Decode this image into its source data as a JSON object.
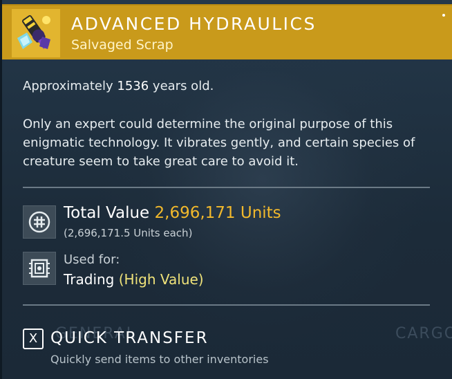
{
  "item": {
    "name": "ADVANCED HYDRAULICS",
    "category": "Salvaged Scrap",
    "icon": "hydraulic-artifact-icon"
  },
  "age": {
    "prefix": "Approximately",
    "years": "1536",
    "suffix": "years old."
  },
  "description": "Only an expert could determine the original purpose of this enigmatic technology. It vibrates gently, and certain species of creature seem to take great care to avoid it.",
  "value": {
    "label": "Total Value",
    "amount": "2,696,171 Units",
    "each": "(2,696,171.5 Units each)",
    "icon": "units-currency-icon"
  },
  "usage": {
    "label": "Used for:",
    "value": "Trading",
    "qualifier": "(High Value)",
    "icon": "trading-chip-icon"
  },
  "quick_transfer": {
    "key": "X",
    "title": "QUICK TRANSFER",
    "description": "Quickly send items to other inventories"
  },
  "background_labels": {
    "left": "GENERAL",
    "right": "CARGO"
  },
  "colors": {
    "header": "#c99a1b",
    "value_accent": "#f2b92c",
    "highlight": "#f0e37a",
    "panel": "#1f2e3c"
  }
}
